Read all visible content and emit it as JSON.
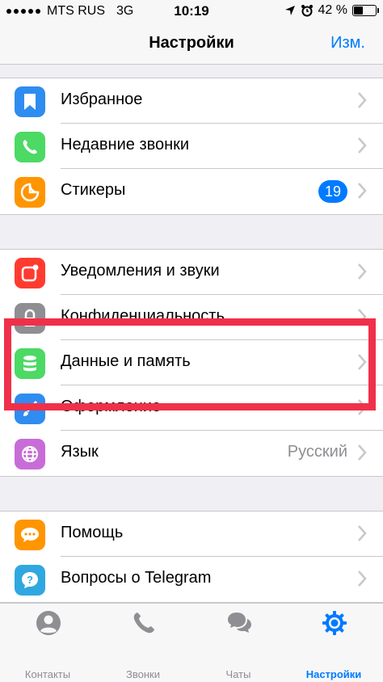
{
  "status_bar": {
    "carrier": "MTS RUS",
    "network": "3G",
    "time": "10:19",
    "battery": "42 %",
    "battery_level": 0.42
  },
  "nav": {
    "title": "Настройки",
    "edit_label": "Изм."
  },
  "groups": [
    {
      "items": [
        {
          "label": "Избранное",
          "icon": "bookmark-icon",
          "color": "#2f8cf0"
        },
        {
          "label": "Недавние звонки",
          "icon": "phone-icon",
          "color": "#4cd964"
        },
        {
          "label": "Стикеры",
          "icon": "sticker-icon",
          "color": "#ff9500",
          "badge": "19"
        }
      ]
    },
    {
      "items": [
        {
          "label": "Уведомления и звуки",
          "icon": "notification-icon",
          "color": "#ff3b30"
        },
        {
          "label": "Конфиденциальность",
          "icon": "lock-icon",
          "color": "#8e8e93"
        },
        {
          "label": "Данные и память",
          "icon": "database-icon",
          "color": "#4cd964"
        },
        {
          "label": "Оформление",
          "icon": "brush-icon",
          "color": "#2f8cf0"
        },
        {
          "label": "Язык",
          "icon": "globe-icon",
          "color": "#c86dd7",
          "value": "Русский"
        }
      ]
    },
    {
      "items": [
        {
          "label": "Помощь",
          "icon": "chat-bubble-icon",
          "color": "#ff9500"
        },
        {
          "label": "Вопросы о Telegram",
          "icon": "question-icon",
          "color": "#2fa8e0"
        }
      ]
    }
  ],
  "tabs": [
    {
      "label": "Контакты",
      "icon": "person-icon",
      "active": false
    },
    {
      "label": "Звонки",
      "icon": "phone-icon",
      "active": false
    },
    {
      "label": "Чаты",
      "icon": "chats-icon",
      "active": false
    },
    {
      "label": "Настройки",
      "icon": "gear-icon",
      "active": true
    }
  ],
  "colors": {
    "accent": "#007aff",
    "highlight_frame": "#f0304a"
  }
}
